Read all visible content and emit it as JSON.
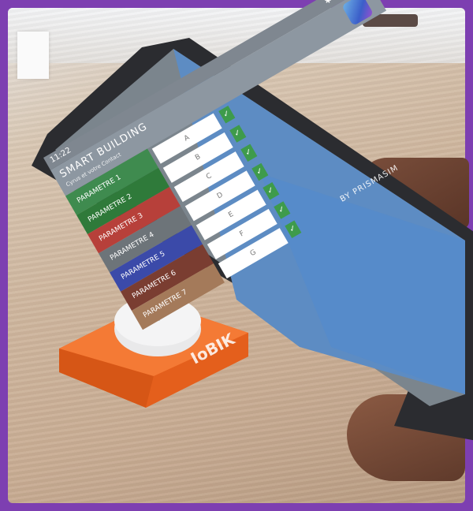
{
  "status": {
    "time": "11:22",
    "icons": [
      "bluetooth-icon",
      "alarm-icon",
      "battery-icon"
    ]
  },
  "app": {
    "title": "SMART BUILDING",
    "subtitle": "Cyrus et votre Contact"
  },
  "params": [
    {
      "label": "PARAMETRE 1",
      "value": "A",
      "color": "#3f8b4f"
    },
    {
      "label": "PARAMETRE 2",
      "value": "B",
      "color": "#2f7a3a"
    },
    {
      "label": "PARAMETRE 3",
      "value": "C",
      "color": "#b7403a"
    },
    {
      "label": "PARAMETRE 4",
      "value": "D",
      "color": "#6d7479"
    },
    {
      "label": "PARAMETRE 5",
      "value": "E",
      "color": "#3b4aa9"
    },
    {
      "label": "PARAMETRE 6",
      "value": "F",
      "color": "#7a3d31"
    },
    {
      "label": "PARAMETRE 7",
      "value": "G",
      "color": "#a47a5a"
    }
  ],
  "footer": {
    "credit": "BY PRISMASIM"
  },
  "device": {
    "brand": "IoBIK",
    "base_color": "#f06a25",
    "knob_color": "#e9e9ea"
  }
}
